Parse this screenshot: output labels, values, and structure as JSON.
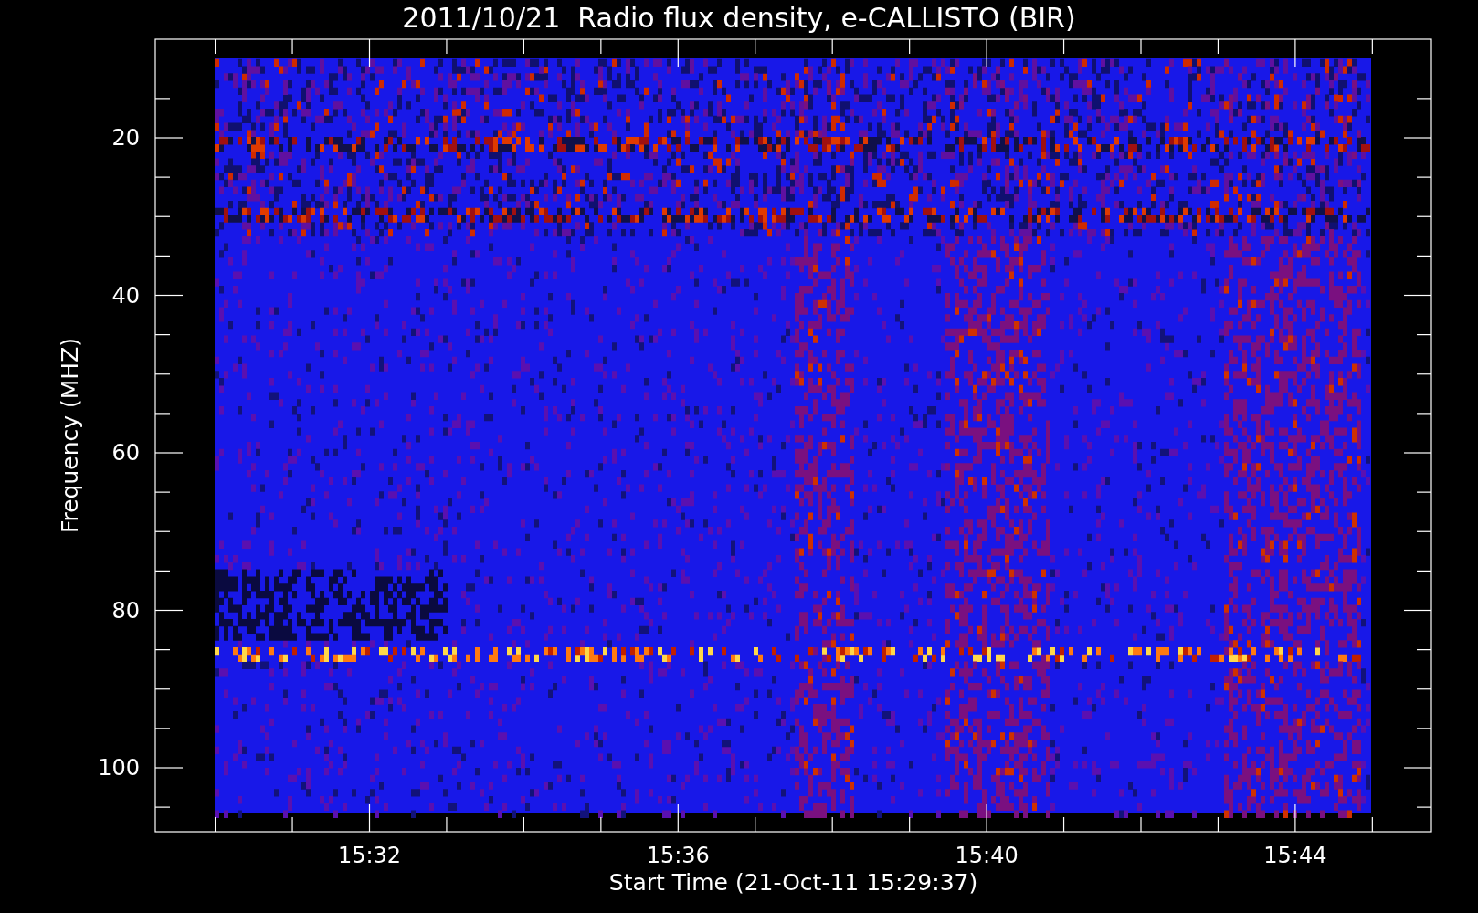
{
  "title": "2011/10/21  Radio flux density, e-CALLISTO (BIR)",
  "plot": {
    "ylabel": "Frequency (MHZ)",
    "xlabel": "Start Time (21-Oct-11 15:29:37)",
    "yticks": [
      "20",
      "40",
      "60",
      "80",
      "100"
    ],
    "xticks": [
      "15:32",
      "15:36",
      "15:40",
      "15:44"
    ]
  }
}
